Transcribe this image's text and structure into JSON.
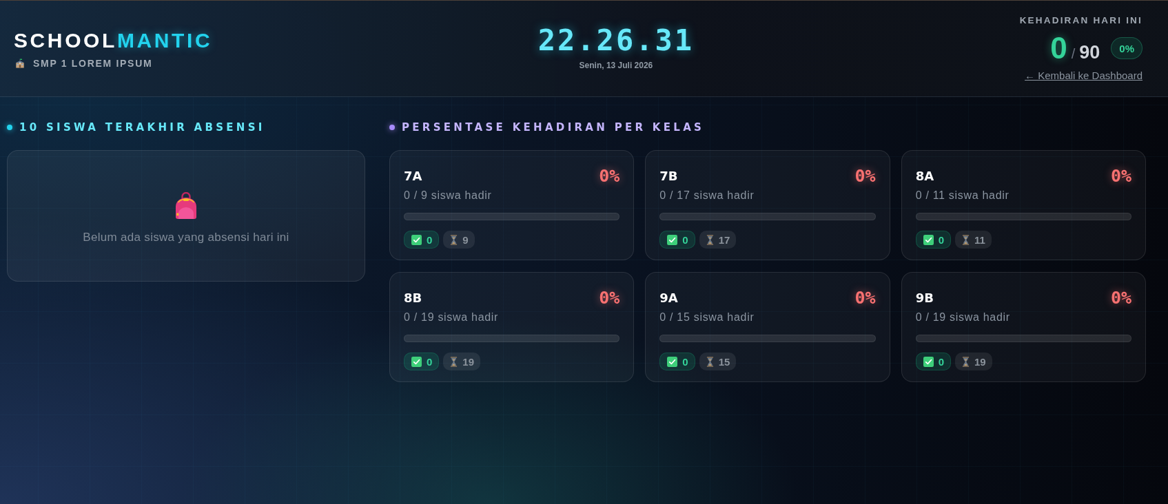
{
  "header": {
    "brand": [
      {
        "text": "SCHOOL",
        "accent": false
      },
      {
        "text": "MANTIC",
        "accent": true
      }
    ],
    "school": "SMP 1 LOREM IPSUM",
    "clock": "22.26.31",
    "date": "Senin, 13 Juli 2026",
    "attendance": {
      "label": "KEHADIRAN HARI INI",
      "present": "0",
      "separator": "/",
      "total": "90",
      "percent": "0%"
    },
    "back_link": "← Kembali ke Dashboard"
  },
  "recent": {
    "title": "10 SISWA TERAKHIR ABSENSI",
    "empty_message": "Belum ada siswa yang absensi hari ini"
  },
  "classes": {
    "title": "PERSENTASE KEHADIRAN PER KELAS",
    "items": [
      {
        "name": "7A",
        "percent": "0%",
        "summary": "0 / 9 siswa hadir",
        "level": 0,
        "present": "0",
        "pending": "9"
      },
      {
        "name": "7B",
        "percent": "0%",
        "summary": "0 / 17 siswa hadir",
        "level": 0,
        "present": "0",
        "pending": "17"
      },
      {
        "name": "8A",
        "percent": "0%",
        "summary": "0 / 11 siswa hadir",
        "level": 0,
        "present": "0",
        "pending": "11"
      },
      {
        "name": "8B",
        "percent": "0%",
        "summary": "0 / 19 siswa hadir",
        "level": 0,
        "present": "0",
        "pending": "19"
      },
      {
        "name": "9A",
        "percent": "0%",
        "summary": "0 / 15 siswa hadir",
        "level": 0,
        "present": "0",
        "pending": "15"
      },
      {
        "name": "9B",
        "percent": "0%",
        "summary": "0 / 19 siswa hadir",
        "level": 0,
        "present": "0",
        "pending": "19"
      }
    ]
  }
}
